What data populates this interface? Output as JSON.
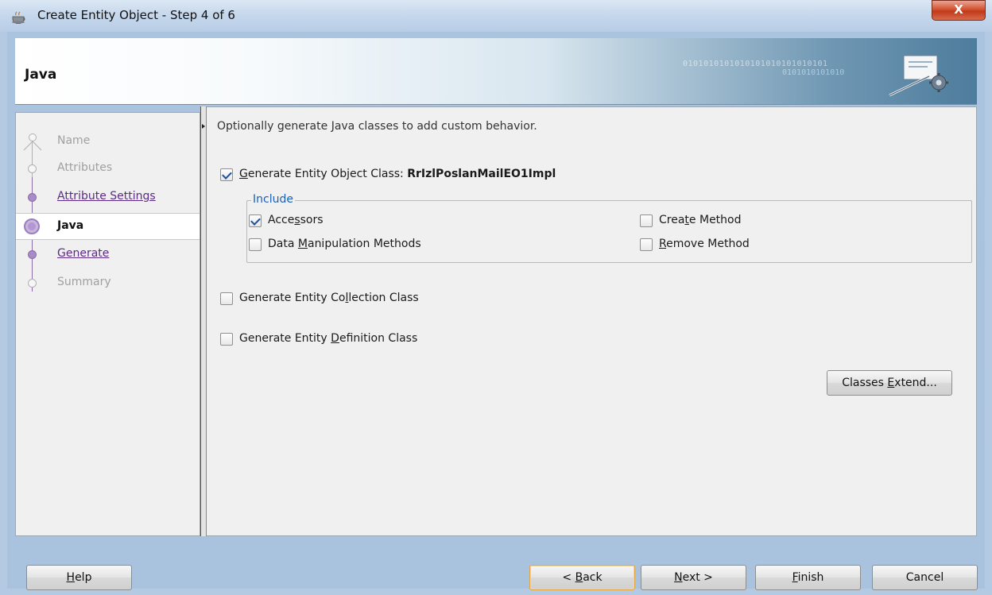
{
  "window": {
    "title": "Create Entity Object - Step 4 of 6",
    "close_label": "X"
  },
  "header": {
    "title": "Java",
    "binary_top": "0101010101010101010101010101",
    "binary_bottom": "0101010101010"
  },
  "train": {
    "steps": [
      {
        "label": "Name",
        "state": "disabled"
      },
      {
        "label": "Attributes",
        "state": "disabled"
      },
      {
        "label": "Attribute Settings",
        "state": "link"
      },
      {
        "label": "Java",
        "state": "current"
      },
      {
        "label": "Generate",
        "state": "link"
      },
      {
        "label": "Summary",
        "state": "disabled"
      }
    ]
  },
  "main": {
    "description": "Optionally generate Java classes to add custom behavior.",
    "entity_object_class": {
      "pre": "",
      "mnemonic": "G",
      "post": "enerate Entity Object Class: ",
      "class_name": "RrIzlPoslanMailEO1Impl",
      "checked": true
    },
    "include": {
      "legend": "Include",
      "accessors": {
        "pre": "Acce",
        "mnemonic": "s",
        "post": "sors",
        "checked": true
      },
      "data_manipulation": {
        "pre": "Data ",
        "mnemonic": "M",
        "post": "anipulation Methods",
        "checked": false
      },
      "create_method": {
        "pre": "Crea",
        "mnemonic": "t",
        "post": "e Method",
        "checked": false
      },
      "remove_method": {
        "pre": "",
        "mnemonic": "R",
        "post": "emove Method",
        "checked": false
      }
    },
    "collection_class": {
      "pre": "Generate Entity Co",
      "mnemonic": "l",
      "post": "lection Class",
      "checked": false
    },
    "definition_class": {
      "pre": "Generate Entity ",
      "mnemonic": "D",
      "post": "efinition Class",
      "checked": false
    },
    "classes_extend": {
      "pre": "Classes ",
      "mnemonic": "E",
      "post": "xtend..."
    }
  },
  "footer": {
    "help": {
      "pre": "",
      "mnemonic": "H",
      "post": "elp"
    },
    "back": {
      "pre": "< ",
      "mnemonic": "B",
      "post": "ack"
    },
    "next": {
      "pre": "",
      "mnemonic": "N",
      "post": "ext >"
    },
    "finish": {
      "pre": "",
      "mnemonic": "F",
      "post": "inish"
    },
    "cancel": {
      "label": "Cancel"
    }
  }
}
